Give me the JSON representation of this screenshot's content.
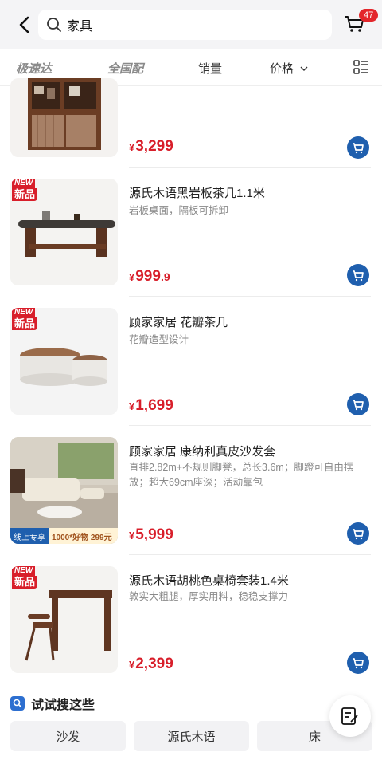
{
  "header": {
    "search_query": "家具",
    "cart_count": "47"
  },
  "filters": [
    {
      "label": "极速达"
    },
    {
      "label": "全国配"
    },
    {
      "label": "销量"
    },
    {
      "label": "价格"
    }
  ],
  "products": [
    {
      "title": "",
      "subtitle": "",
      "price_int": "3,299",
      "price_dec": "",
      "new": false,
      "banner": false
    },
    {
      "title": "源氏木语黑岩板茶几1.1米",
      "subtitle": "岩板桌面，隔板可拆卸",
      "price_int": "999",
      "price_dec": ".9",
      "new": true,
      "banner": false
    },
    {
      "title": "顾家家居 花瓣茶几",
      "subtitle": "花瓣造型设计",
      "price_int": "1,699",
      "price_dec": "",
      "new": true,
      "banner": false
    },
    {
      "title": "顾家家居 康纳利真皮沙发套",
      "subtitle": "直排2.82m+不规则脚凳，总长3.6m；脚蹬可自由摆放；超大69cm座深；活动靠包",
      "price_int": "5,999",
      "price_dec": "",
      "new": false,
      "banner": true
    },
    {
      "title": "源氏木语胡桃色桌椅套装1.4米",
      "subtitle": "敦实大粗腿，厚实用料，稳稳支撑力",
      "price_int": "2,399",
      "price_dec": "",
      "new": true,
      "banner": false
    }
  ],
  "labels": {
    "currency": "¥",
    "new_top": "NEW",
    "new_bottom": "新品",
    "banner_left": "线上专享",
    "banner_right": "1000*好物 299元包邮"
  },
  "suggest": {
    "title": "试试搜这些",
    "chips": [
      "沙发",
      "源氏木语",
      "床"
    ]
  },
  "colors": {
    "accent_red": "#d81e2a",
    "cart_blue": "#1f5fae"
  }
}
